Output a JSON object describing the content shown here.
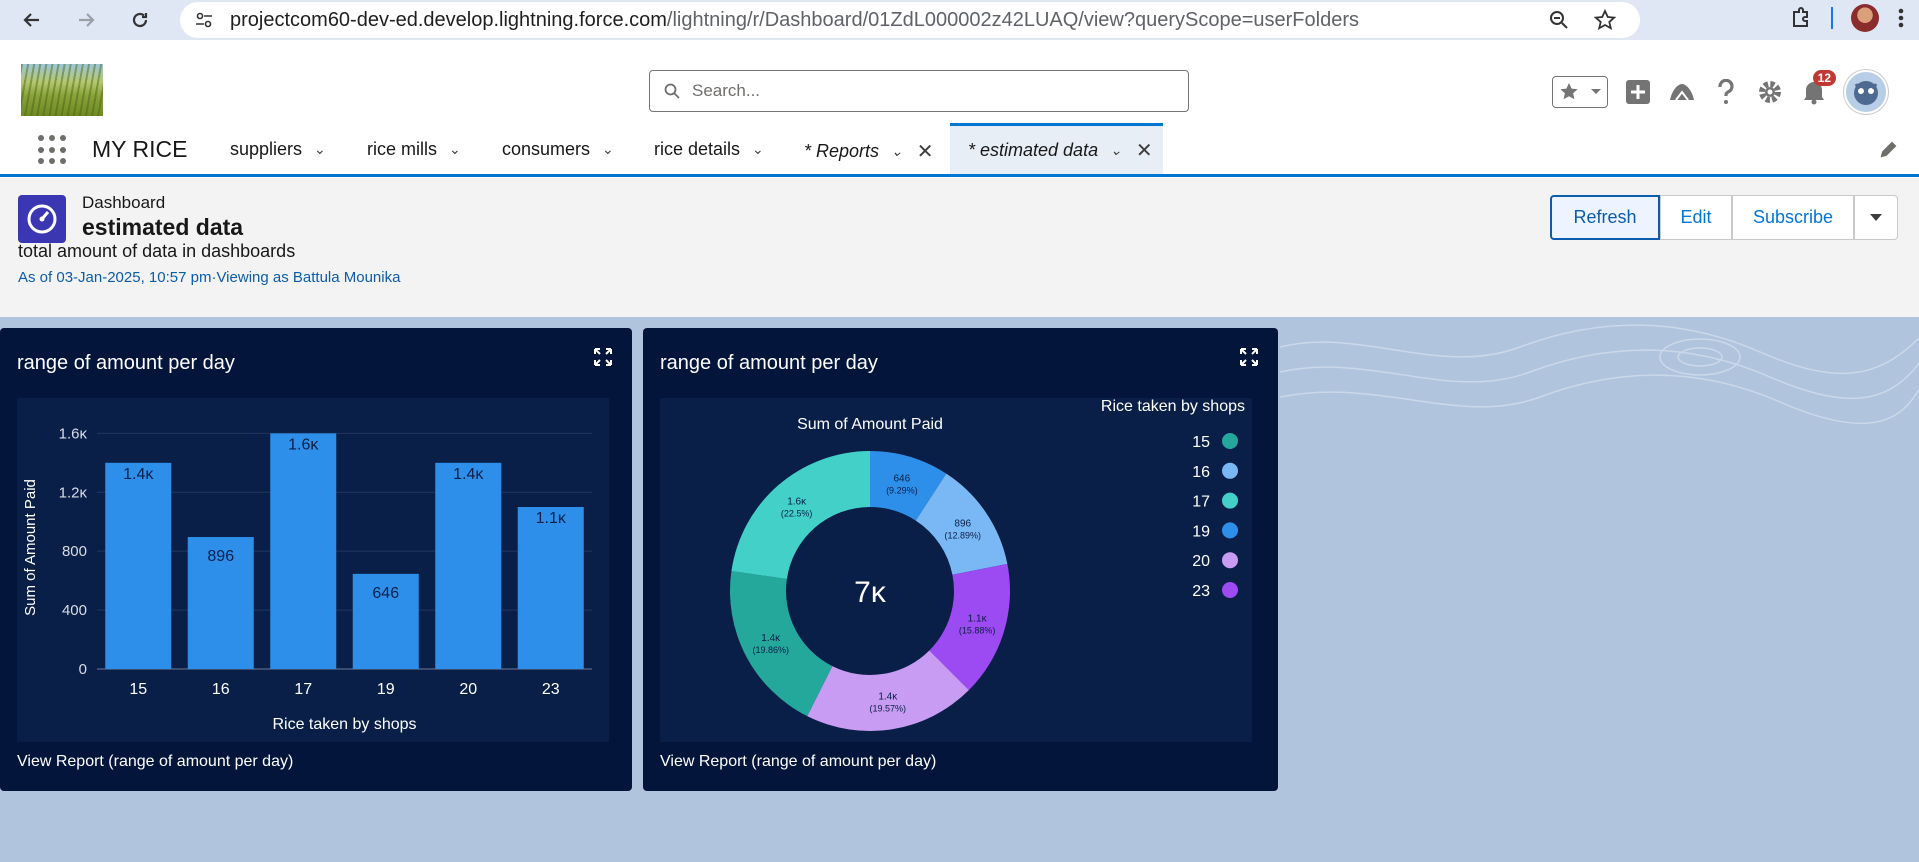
{
  "browser": {
    "url_host": "projectcom60-dev-ed.develop.lightning.force.com",
    "url_path": "/lightning/r/Dashboard/01ZdL000002z42LUAQ/view?queryScope=userFolders"
  },
  "header": {
    "search_placeholder": "Search...",
    "notification_count": "12"
  },
  "app_nav": {
    "app_name": "MY RICE",
    "items": [
      {
        "label": "suppliers"
      },
      {
        "label": "rice mills"
      },
      {
        "label": "consumers"
      },
      {
        "label": "rice details"
      },
      {
        "label": "* Reports"
      },
      {
        "label": "* estimated data"
      }
    ]
  },
  "dashboard": {
    "kicker": "Dashboard",
    "title": "estimated data",
    "description": "total amount of data in dashboards",
    "meta": "As of 03-Jan-2025, 10:57 pm·Viewing as Battula Mounika",
    "buttons": {
      "refresh": "Refresh",
      "edit": "Edit",
      "subscribe": "Subscribe"
    }
  },
  "widgets": [
    {
      "title": "range of amount per day",
      "link": "View Report (range of amount per day)"
    },
    {
      "title": "range of amount per day",
      "link": "View Report (range of amount per day)"
    }
  ],
  "colors": {
    "bar": "#2d8fea",
    "slices": [
      "#24a89c",
      "#7ab8f5",
      "#42d0c9",
      "#2d8fea",
      "#c89cf2",
      "#9c4af2"
    ]
  },
  "chart_data": [
    {
      "type": "bar",
      "categories": [
        "15",
        "16",
        "17",
        "19",
        "20",
        "23"
      ],
      "values": [
        1400,
        896,
        1600,
        646,
        1400,
        1100
      ],
      "data_labels": [
        "1.4ĸ",
        "896",
        "1.6ĸ",
        "646",
        "1.4ĸ",
        "1.1ĸ"
      ],
      "xlabel": "Rice taken by shops",
      "ylabel": "Sum of Amount Paid",
      "yticks": [
        "0",
        "400",
        "800",
        "1.2ĸ",
        "1.6ĸ"
      ],
      "ylim": [
        0,
        1650
      ]
    },
    {
      "type": "pie",
      "title": "Sum of Amount Paid",
      "legend_title": "Rice taken by shops",
      "center_label": "7ĸ",
      "categories": [
        "15",
        "16",
        "17",
        "19",
        "20",
        "23"
      ],
      "values": [
        1400,
        896,
        1600,
        646,
        1400,
        1100
      ],
      "value_labels": [
        "1.4ĸ",
        "896",
        "1.6ĸ",
        "646",
        "1.4ĸ",
        "1.1ĸ"
      ],
      "percent_labels": [
        "(19.86%)",
        "(12.89%)",
        "(22.5%)",
        "(9.29%)",
        "(19.57%)",
        "(15.88%)"
      ],
      "legend_placement": "top-right"
    }
  ]
}
